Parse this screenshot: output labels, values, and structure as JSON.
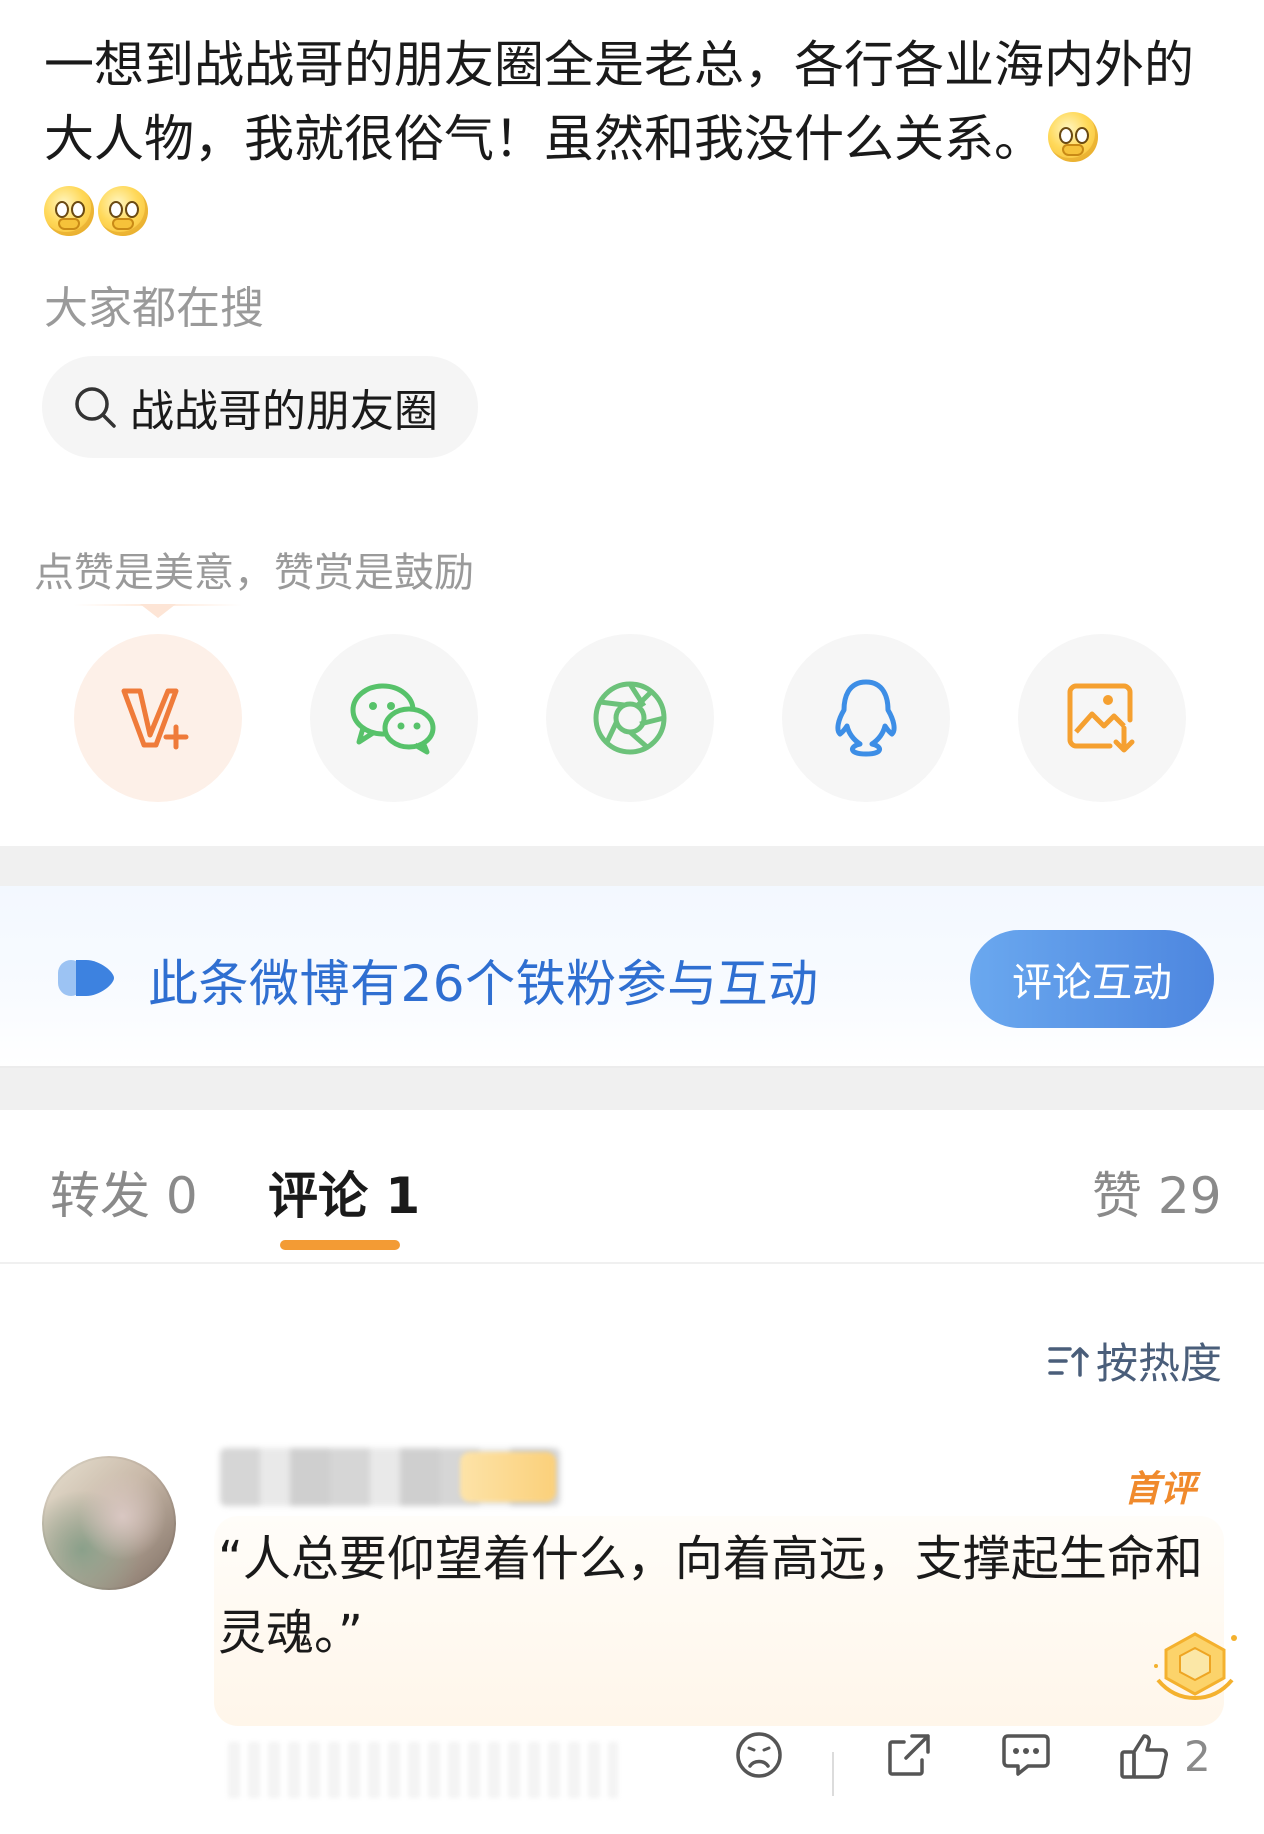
{
  "post": {
    "text": "一想到战战哥的朋友圈全是老总，各行各业海内外的大人物，我就很俗气！虽然和我没什么关系。",
    "emojis": [
      "doge-thinking-emoji",
      "doge-thinking-emoji",
      "doge-thinking-emoji"
    ]
  },
  "trending": {
    "title": "大家都在搜",
    "chip_label": "战战哥的朋友圈"
  },
  "reward": {
    "hint": "点赞是美意，赞赏是鼓励"
  },
  "share": {
    "items": [
      {
        "icon": "vip-reward-icon"
      },
      {
        "icon": "wechat-icon"
      },
      {
        "icon": "moments-icon"
      },
      {
        "icon": "qq-icon"
      },
      {
        "icon": "save-image-icon"
      }
    ]
  },
  "fans_banner": {
    "text": "此条微博有26个铁粉参与互动",
    "button": "评论互动"
  },
  "tabs": {
    "repost": "转发 0",
    "comments": "评论 1",
    "likes": "赞 29"
  },
  "sort": {
    "label": "按热度"
  },
  "comment": {
    "badge": "首评",
    "text": "“人总要仰望着什么，向着高远，支撑起生命和灵魂。”",
    "like_count": "2"
  },
  "colors": {
    "accent_orange": "#f39b34",
    "fans_blue": "#2f6fd1",
    "button_blue": "#4d86df",
    "wechat_green": "#57c26a",
    "qq_blue": "#3d8ee6"
  }
}
